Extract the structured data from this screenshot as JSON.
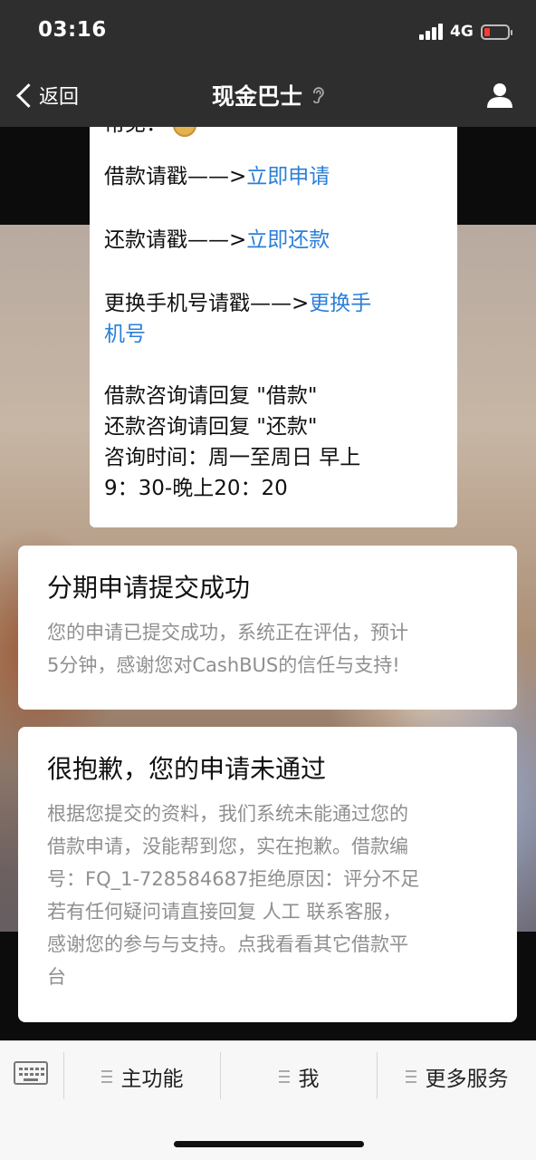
{
  "status_bar": {
    "time": "03:16",
    "network": "4G",
    "battery_color": "#ff3b30"
  },
  "nav": {
    "back_label": "返回",
    "title": "现金巴士",
    "title_icon": "ear-icon",
    "right_icon": "profile-icon"
  },
  "message": {
    "partial_line": "常见：",
    "borrow_prefix": "借款请戳——>",
    "borrow_link": "立即申请",
    "repay_prefix": "还款请戳——>",
    "repay_link": "立即还款",
    "phone_prefix": "更换手机号请戳——>",
    "phone_link_part1": "更换手",
    "phone_link_part2": "机号",
    "reply_borrow": "借款咨询请回复 \"借款\"",
    "reply_repay": "还款咨询请回复 \"还款\"",
    "hours_line1": "咨询时间：周一至周日 早上",
    "hours_line2": "9：30-晚上20：20"
  },
  "cards": [
    {
      "title": "分期申请提交成功",
      "body_lines": [
        "您的申请已提交成功，系统正在评估，预计",
        "5分钟，感谢您对CashBUS的信任与支持!"
      ]
    },
    {
      "title": "很抱歉，您的申请未通过",
      "body_lines": [
        "根据您提交的资料，我们系统未能通过您的",
        "借款申请，没能帮到您，实在抱歉。借款编",
        "号：FQ_1-728584687拒绝原因：评分不足",
        "若有任何疑问请直接回复 人工 联系客服，",
        "感谢您的参与与支持。点我看看其它借款平",
        "台"
      ]
    }
  ],
  "bottom_menu": {
    "keyboard_icon": "keyboard-icon",
    "items": [
      "主功能",
      "我",
      "更多服务"
    ]
  },
  "colors": {
    "link": "#2b7fd8",
    "nav_bg": "#2e2e2e",
    "card_body": "#8f8f8f"
  }
}
